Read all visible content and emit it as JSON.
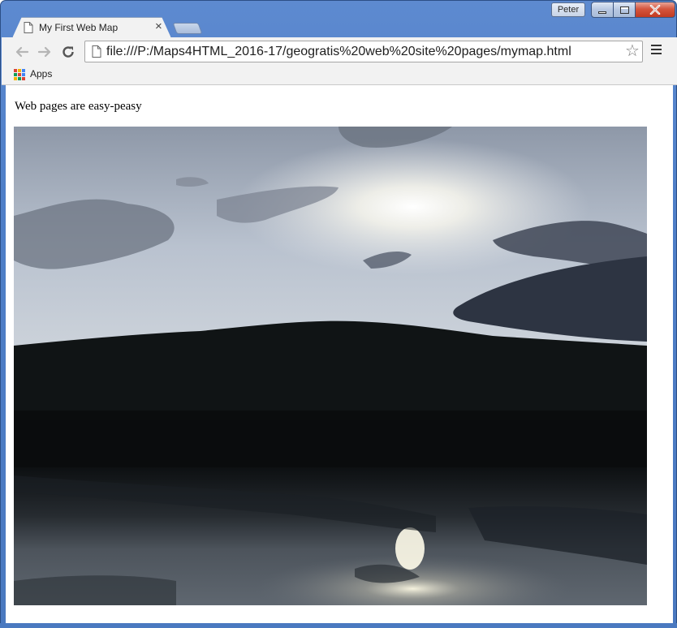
{
  "window": {
    "profile_name": "Peter",
    "accent_color": "#4f7fc8",
    "close_color": "#c23b22"
  },
  "tabs": [
    {
      "label": "My First Web Map",
      "active": true,
      "icon": "page-icon"
    }
  ],
  "toolbar": {
    "url": "file:///P:/Maps4HTML_2016-17/geogratis%20web%20site%20pages/mymap.html",
    "back_icon": "back-arrow-icon",
    "forward_icon": "forward-arrow-icon",
    "reload_icon": "reload-icon",
    "bookmark_icon": "star-icon",
    "menu_icon": "hamburger-menu-icon"
  },
  "bookmarks_bar": {
    "items": [
      {
        "label": "Apps",
        "icon": "apps-grid-icon"
      }
    ]
  },
  "page": {
    "text": "Web pages are easy-peasy",
    "image": "photo of sunset over a forested hill and lake"
  }
}
